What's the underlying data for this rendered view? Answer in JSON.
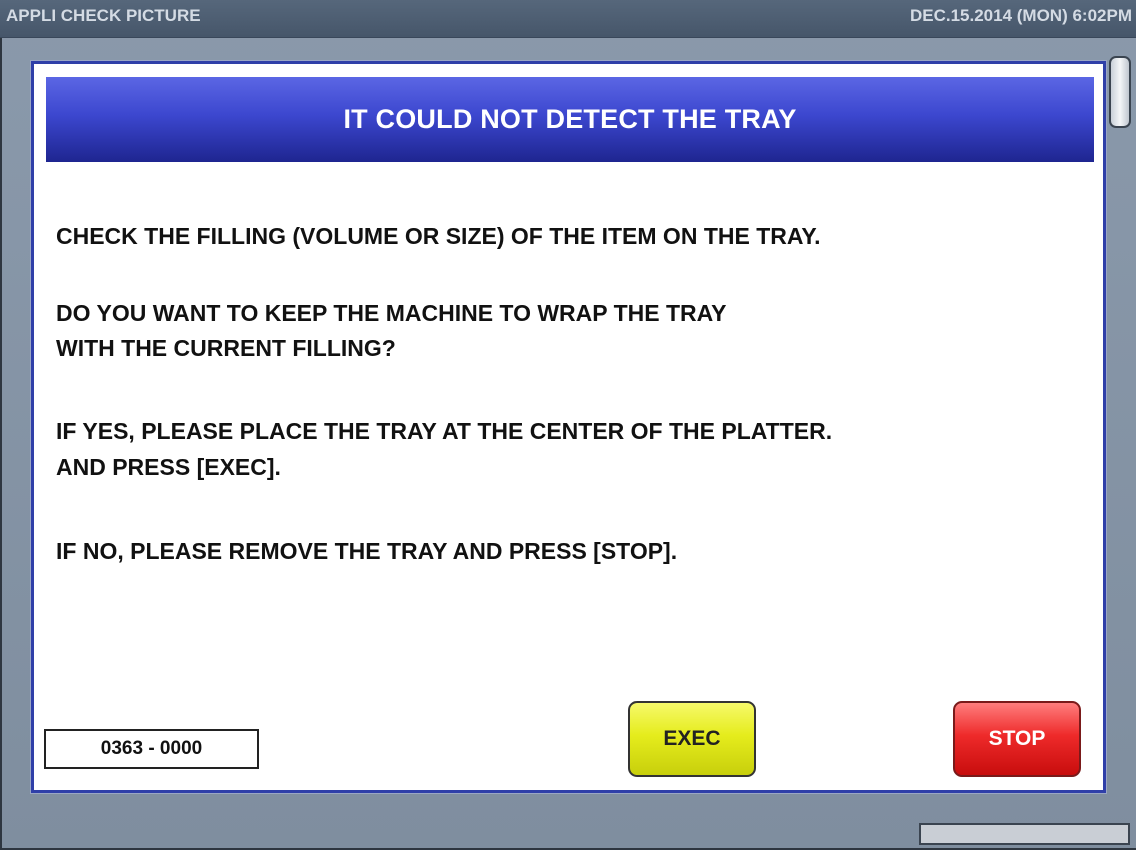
{
  "title_bar": {
    "app_title": "APPLI CHECK PICTURE",
    "datetime": "DEC.15.2014 (MON)   6:02PM"
  },
  "dialog": {
    "title": "IT COULD NOT DETECT THE TRAY",
    "lines": [
      "CHECK THE FILLING (VOLUME OR SIZE) OF THE ITEM ON THE TRAY.",
      "DO YOU WANT TO KEEP THE MACHINE TO WRAP THE TRAY",
      "WITH THE CURRENT FILLING?",
      "IF YES, PLEASE PLACE THE TRAY AT THE CENTER OF THE PLATTER.",
      "AND PRESS [EXEC].",
      "IF NO, PLEASE REMOVE THE TRAY AND PRESS [STOP]."
    ],
    "code": "0363 - 0000",
    "exec_label": "EXEC",
    "stop_label": "STOP"
  },
  "colors": {
    "header_blue": "#3c47cf",
    "exec_yellow": "#e5ec1c",
    "stop_red": "#ee2a2a"
  }
}
